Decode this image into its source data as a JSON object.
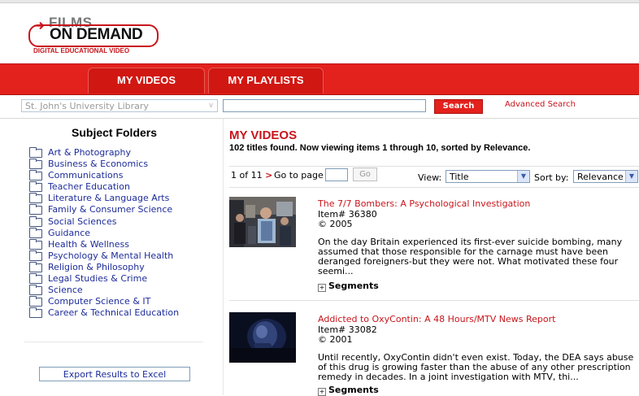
{
  "brand": {
    "films": "FILMS",
    "on_demand": "ON DEMAND",
    "tagline": "DIGITAL EDUCATIONAL VIDEO"
  },
  "nav": {
    "tabs": [
      {
        "label": "MY VIDEOS"
      },
      {
        "label": "MY PLAYLISTS"
      }
    ]
  },
  "search": {
    "library": "St. John's University Library",
    "query": "",
    "button": "Search",
    "advanced": "Advanced Search"
  },
  "sidebar": {
    "title": "Subject Folders",
    "folders": [
      "Art & Photography",
      "Business & Economics",
      "Communications",
      "Teacher Education",
      "Literature & Language Arts",
      "Family & Consumer Science",
      "Social Sciences",
      "Guidance",
      "Health & Wellness",
      "Psychology & Mental Health",
      "Religion & Philosophy",
      "Legal Studies & Crime",
      "Science",
      "Computer Science & IT",
      "Career & Technical Education"
    ],
    "export": "Export Results to Excel"
  },
  "main": {
    "title": "MY VIDEOS",
    "summary": "102 titles found. Now viewing items 1 through 10, sorted by Relevance.",
    "pager": {
      "page_info": "1 of 11",
      "next": ">",
      "goto": "Go to page",
      "page_value": "",
      "go": "Go",
      "view_label": "View:",
      "view_value": "Title",
      "sort_label": "Sort by:",
      "sort_value": "Relevance"
    },
    "results": [
      {
        "title": "The 7/7 Bombers: A Psychological Investigation",
        "item": "Item# 36380",
        "year": "© 2005",
        "desc": "On the day Britain experienced its first-ever suicide bombing, many assumed that those responsible for the carnage must have been deranged foreigners-but they were not. What motivated these four seemi...",
        "segments": "Segments"
      },
      {
        "title": "Addicted to OxyContin: A 48 Hours/MTV News Report",
        "item": "Item# 33082",
        "year": "© 2001",
        "desc": "Until recently, OxyContin didn't even exist. Today, the DEA says abuse of this drug is growing faster than the abuse of any other prescription remedy in decades. In a joint investigation with MTV, thi...",
        "segments": "Segments"
      }
    ]
  },
  "colors": {
    "brand_red": "#e3211d",
    "link_red": "#c8151b",
    "folder_link": "#1d2c9a"
  }
}
